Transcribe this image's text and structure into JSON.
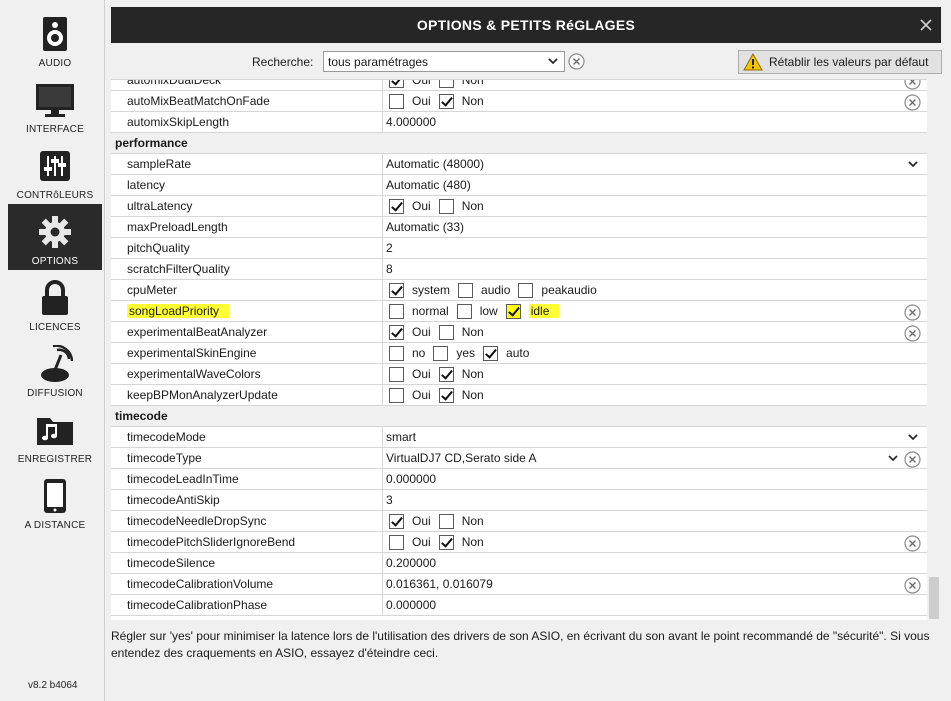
{
  "sidebar": {
    "items": [
      {
        "label": "AUDIO",
        "icon": "speaker-icon"
      },
      {
        "label": "INTERFACE",
        "icon": "monitor-icon"
      },
      {
        "label": "CONTRôLEURS",
        "icon": "sliders-icon"
      },
      {
        "label": "OPTIONS",
        "icon": "gear-icon",
        "active": true
      },
      {
        "label": "LICENCES",
        "icon": "lock-icon"
      },
      {
        "label": "DIFFUSION",
        "icon": "broadcast-icon"
      },
      {
        "label": "ENREGISTRER",
        "icon": "music-folder-icon"
      },
      {
        "label": "A DISTANCE",
        "icon": "phone-icon"
      }
    ],
    "version": "v8.2 b4064"
  },
  "window": {
    "title": "OPTIONS & PETITS RéGLAGES",
    "close": "✕"
  },
  "search": {
    "label": "Recherche:",
    "value": "tous paramétrages"
  },
  "reset": {
    "label": "Rétablir les valeurs par défaut"
  },
  "rows": [
    {
      "name": "automixDualDeck",
      "opts": [
        {
          "label": "Oui",
          "checked": true
        },
        {
          "label": "Non",
          "checked": false
        }
      ],
      "clear": true
    },
    {
      "name": "autoMixBeatMatchOnFade",
      "opts": [
        {
          "label": "Oui",
          "checked": false
        },
        {
          "label": "Non",
          "checked": true
        }
      ],
      "clear": true
    },
    {
      "name": "automixSkipLength",
      "value": "4.000000"
    },
    {
      "category": "performance"
    },
    {
      "name": "sampleRate",
      "value": "Automatic (48000)",
      "dropdown": true
    },
    {
      "name": "latency",
      "value": "Automatic (480)"
    },
    {
      "name": "ultraLatency",
      "opts": [
        {
          "label": "Oui",
          "checked": true
        },
        {
          "label": "Non",
          "checked": false
        }
      ]
    },
    {
      "name": "maxPreloadLength",
      "value": "Automatic (33)"
    },
    {
      "name": "pitchQuality",
      "value": "2"
    },
    {
      "name": "scratchFilterQuality",
      "value": "8"
    },
    {
      "name": "cpuMeter",
      "opts": [
        {
          "label": "system",
          "checked": true
        },
        {
          "label": "audio",
          "checked": false
        },
        {
          "label": "peakaudio",
          "checked": false
        }
      ]
    },
    {
      "name": "songLoadPriority",
      "highlight": true,
      "opts": [
        {
          "label": "normal",
          "checked": false
        },
        {
          "label": "low",
          "checked": false
        },
        {
          "label": "idle",
          "checked": true,
          "highlight": true
        }
      ],
      "clear": true
    },
    {
      "name": "experimentalBeatAnalyzer",
      "opts": [
        {
          "label": "Oui",
          "checked": true
        },
        {
          "label": "Non",
          "checked": false
        }
      ],
      "clear": true
    },
    {
      "name": "experimentalSkinEngine",
      "opts": [
        {
          "label": "no",
          "checked": false
        },
        {
          "label": "yes",
          "checked": false
        },
        {
          "label": "auto",
          "checked": true
        }
      ]
    },
    {
      "name": "experimentalWaveColors",
      "opts": [
        {
          "label": "Oui",
          "checked": false
        },
        {
          "label": "Non",
          "checked": true
        }
      ]
    },
    {
      "name": "keepBPMonAnalyzerUpdate",
      "opts": [
        {
          "label": "Oui",
          "checked": false
        },
        {
          "label": "Non",
          "checked": true
        }
      ]
    },
    {
      "category": "timecode"
    },
    {
      "name": "timecodeMode",
      "value": "smart",
      "dropdown": true
    },
    {
      "name": "timecodeType",
      "value": "VirtualDJ7 CD,Serato side A",
      "dropdown": true,
      "clear": true
    },
    {
      "name": "timecodeLeadInTime",
      "value": "0.000000"
    },
    {
      "name": "timecodeAntiSkip",
      "value": "3"
    },
    {
      "name": "timecodeNeedleDropSync",
      "opts": [
        {
          "label": "Oui",
          "checked": true
        },
        {
          "label": "Non",
          "checked": false
        }
      ]
    },
    {
      "name": "timecodePitchSliderIgnoreBend",
      "opts": [
        {
          "label": "Oui",
          "checked": false
        },
        {
          "label": "Non",
          "checked": true
        }
      ],
      "clear": true
    },
    {
      "name": "timecodeSilence",
      "value": "0.200000"
    },
    {
      "name": "timecodeCalibrationVolume",
      "value": "0.016361, 0.016079",
      "clear": true
    },
    {
      "name": "timecodeCalibrationPhase",
      "value": "0.000000"
    }
  ],
  "description": "Régler sur 'yes' pour minimiser la latence lors de l'utilisation des drivers de son ASIO, en écrivant du son avant le point recommandé de \"sécurité\". Si vous entendez des craquements en ASIO, essayez d'éteindre ceci.",
  "colors": {
    "titlebar": "#262626",
    "active_nav": "#2a2a2a",
    "highlight": "#ffff00"
  }
}
